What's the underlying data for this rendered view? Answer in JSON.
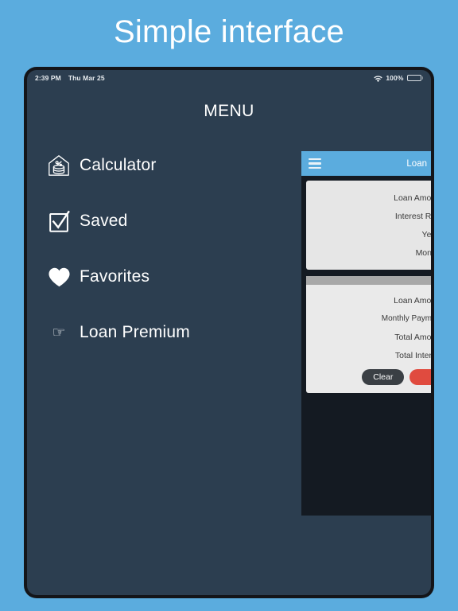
{
  "headline": "Simple interface",
  "device": {
    "status_bar": {
      "time": "2:39 PM",
      "date": "Thu Mar 25",
      "wifi_icon": "wifi-icon",
      "battery_percent": "100%",
      "battery_icon": "battery-full-icon"
    },
    "menu": {
      "title": "MENU",
      "items": [
        {
          "label": "Calculator",
          "icon": "home-loan-calculator-icon"
        },
        {
          "label": "Saved",
          "icon": "checkbox-checked-icon"
        },
        {
          "label": "Favorites",
          "icon": "heart-icon"
        },
        {
          "label": "Loan Premium",
          "icon": "pointing-hand-icon"
        }
      ]
    },
    "preview": {
      "appbar": {
        "menu_icon": "hamburger-menu-icon",
        "title": "Loan"
      },
      "input_card": {
        "fields": [
          {
            "label": "Loan Amount"
          },
          {
            "label": "Interest Rate"
          },
          {
            "label": "Years"
          },
          {
            "label": "Months"
          }
        ],
        "action_icon": "green-circle-button"
      },
      "result_card": {
        "fields": [
          {
            "label": "Loan Amount"
          },
          {
            "label": "Monthly Payment"
          },
          {
            "label": "Total Amount"
          },
          {
            "label": "Total Interest"
          }
        ],
        "buttons": [
          {
            "label": "Clear",
            "style": "dark"
          },
          {
            "label": "",
            "style": "danger"
          }
        ]
      }
    }
  },
  "colors": {
    "background": "#5bacde",
    "screen": "#2c3e50",
    "accent": "#5bacde",
    "bezel": "#141519",
    "panel_dark": "#141a22",
    "green": "#27c24c",
    "red": "#e04b3f"
  }
}
